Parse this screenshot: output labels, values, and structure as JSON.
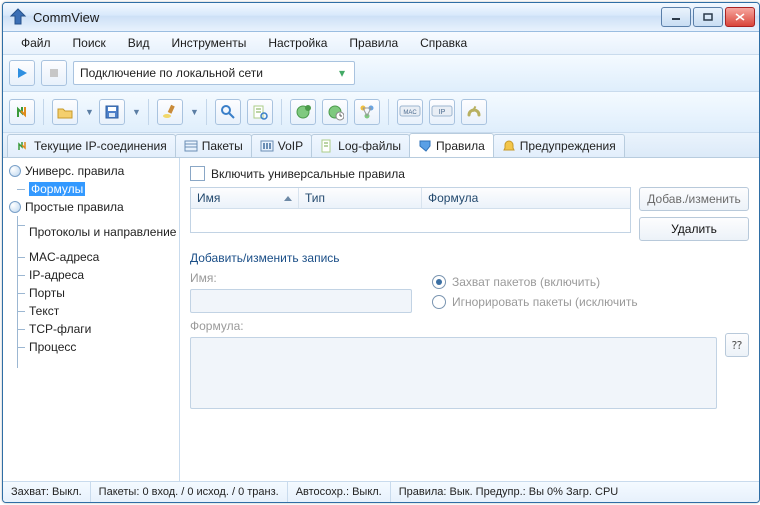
{
  "window": {
    "title": "CommView"
  },
  "menu": {
    "file": "Файл",
    "search": "Поиск",
    "view": "Вид",
    "tools": "Инструменты",
    "settings": "Настройка",
    "rules": "Правила",
    "help": "Справка"
  },
  "toolbar": {
    "adapter_selected": "Подключение по локальной сети",
    "icons": {
      "play": "play-icon",
      "stop": "stop-icon",
      "arrows": "up-down-icon",
      "open": "open-icon",
      "save": "save-icon",
      "brush": "clear-icon",
      "search": "search-icon",
      "logs": "log-icon",
      "net1": "net-green-icon",
      "net2": "net-time-icon",
      "net3": "net-nodes-icon",
      "mac": "mac-tag-icon",
      "ip": "ip-tag-icon",
      "wrench": "wrench-icon"
    }
  },
  "tabs": [
    {
      "id": "connections",
      "label": "Текущие IP-соединения"
    },
    {
      "id": "packets",
      "label": "Пакеты"
    },
    {
      "id": "voip",
      "label": "VoIP"
    },
    {
      "id": "logs",
      "label": "Log-файлы"
    },
    {
      "id": "rules",
      "label": "Правила",
      "active": true
    },
    {
      "id": "alerts",
      "label": "Предупреждения"
    }
  ],
  "sidebar": {
    "root1": "Универс. правила",
    "root1_child": "Формулы",
    "root2": "Простые правила",
    "children": [
      "Протоколы и направление",
      "MAC-адреса",
      "IP-адреса",
      "Порты",
      "Текст",
      "TCP-флаги",
      "Процесс"
    ]
  },
  "content": {
    "enable_label": "Включить универсальные правила",
    "grid": {
      "col_name": "Имя",
      "col_type": "Тип",
      "col_formula": "Формула"
    },
    "btn_add": "Добав./изменить",
    "btn_delete": "Удалить",
    "group_title": "Добавить/изменить запись",
    "lbl_name": "Имя:",
    "radio_capture": "Захват пакетов (включить)",
    "radio_ignore": "Игнорировать пакеты (исключить",
    "lbl_formula": "Формула:",
    "help_glyph": "⁇"
  },
  "status": {
    "capture": "Захват: Выкл.",
    "packets": "Пакеты: 0 вход. / 0 исход. / 0 транз.",
    "autosave": "Автосохр.: Выкл.",
    "rules_alerts": "Правила: Вык.  Предупр.: Вы 0% Загр. CPU"
  }
}
